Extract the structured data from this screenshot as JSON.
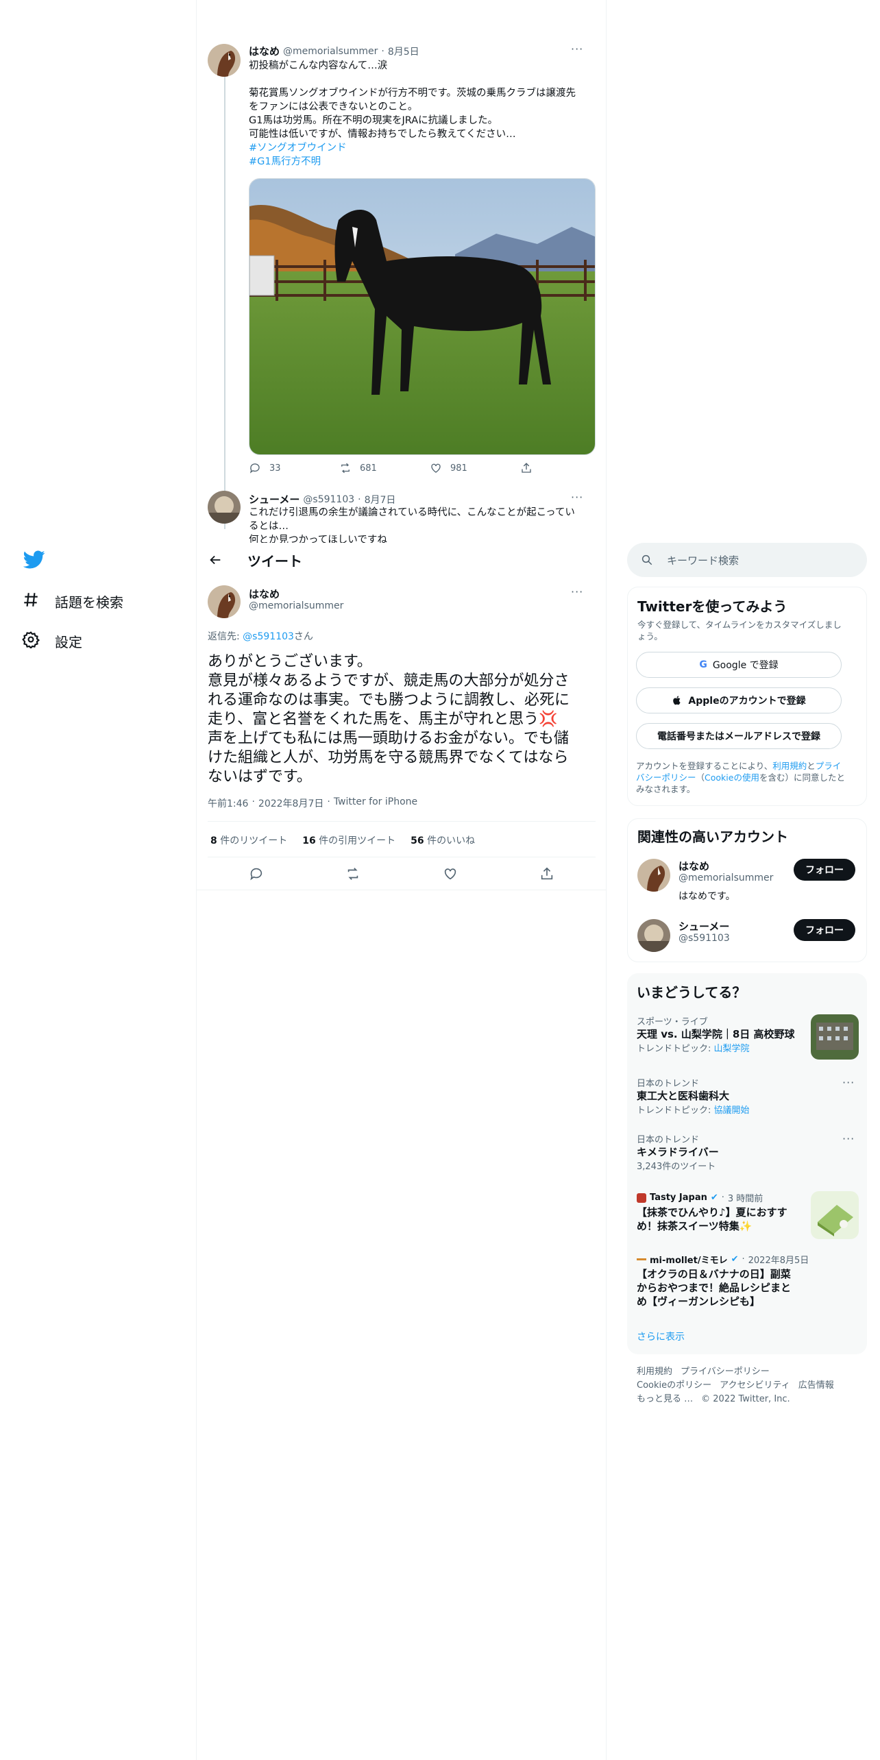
{
  "nav": {
    "items": [
      {
        "label": "話題を検索",
        "icon": "hashtag-icon"
      },
      {
        "label": "設定",
        "icon": "gear-icon"
      }
    ]
  },
  "parent_tweet": {
    "name": "はなめ",
    "handle": "@memorialsummer",
    "date": "8月5日",
    "lines": [
      "初投稿がこんな内容なんて…涙",
      "",
      "菊花賞馬ソングオブウインドが行方不明です。茨城の乗馬クラブは譲渡先",
      "をファンには公表できないとのこと。",
      "G1馬は功労馬。所在不明の現実をJRAに抗議しました。",
      "可能性は低いですが、情報お持ちでしたら教えてください…"
    ],
    "hashtags": [
      "#ソングオブウインド",
      "#G1馬行方不明"
    ],
    "reply_count": "33",
    "retweet_count": "681",
    "like_count": "981"
  },
  "reply_tweet": {
    "name": "シューメー",
    "handle": "@s591103",
    "date": "8月7日",
    "lines": [
      "これだけ引退馬の余生が議論されている時代に、こんなことが起こってい",
      "るとは…",
      "何とか見つかってほしいですね"
    ]
  },
  "header": {
    "title": "ツイート"
  },
  "main_tweet": {
    "name": "はなめ",
    "handle": "@memorialsummer",
    "reply_prefix": "返信先: ",
    "reply_to": "@s591103",
    "reply_suffix": "さん",
    "lines": [
      "ありがとうございます。",
      "意見が様々あるようですが、競走馬の大部分が処分さ",
      "れる運命なのは事実。でも勝つように調教し、必死に",
      "走り、富と名誉をくれた馬を、馬主が守れと思う💢",
      "声を上げても私には馬一頭助けるお金がない。でも儲",
      "けた組織と人が、功労馬を守る競馬界でなくてはなら",
      "ないはずです。"
    ],
    "time": "午前1:46",
    "date": "2022年8月7日",
    "source": "Twitter for iPhone",
    "retweets_num": "8",
    "retweets_label": "件のリツイート",
    "quotes_num": "16",
    "quotes_label": "件の引用ツイート",
    "likes_num": "56",
    "likes_label": "件のいいね"
  },
  "search": {
    "placeholder": "キーワード検索"
  },
  "signup": {
    "title": "Twitterを使ってみよう",
    "subtitle_lines": [
      "今すぐ登録して、タイムラインをカスタマイズしまし",
      "ょう。"
    ],
    "google_button": "Google で登録",
    "apple_button": "Appleのアカウントで登録",
    "phone_button": "電話番号またはメールアドレスで登録",
    "terms_pre": "アカウントを登録することにより、",
    "terms_link1": "利用規約",
    "terms_mid1": "と",
    "terms_link2a": "プライ",
    "terms_link2b": "バシーポリシー",
    "terms_mid2": "（",
    "terms_link3": "Cookieの使用",
    "terms_post": "を含む）に同意したと",
    "terms_post2": "みなされます。"
  },
  "relevant": {
    "title": "関連性の高いアカウント",
    "accounts": [
      {
        "name": "はなめ",
        "handle": "@memorialsummer",
        "bio": "はなめです。",
        "follow": "フォロー"
      },
      {
        "name": "シューメー",
        "handle": "@s591103",
        "bio": "",
        "follow": "フォロー"
      }
    ]
  },
  "trends": {
    "title": "いまどうしてる？",
    "items": [
      {
        "category": "スポーツ・ライブ",
        "name": "天理 vs. 山梨学院｜8日 高校野球",
        "sub_prefix": "トレンドトピック: ",
        "sub_link": "山梨学院"
      },
      {
        "category": "日本のトレンド",
        "name": "東工大と医科歯科大",
        "sub_prefix": "トレンドトピック: ",
        "sub_link": "協議開始"
      },
      {
        "category": "日本のトレンド",
        "name": "キメラドライバー",
        "sub_prefix": "3,243件のツイート",
        "sub_link": ""
      }
    ],
    "news": [
      {
        "source": "Tasty Japan",
        "time": "3 時間前",
        "title_lines": [
          "【抹茶でひんやり♪】夏におすす",
          "め！抹茶スイーツ特集✨"
        ]
      },
      {
        "source": "mi-mollet/ミモレ",
        "time": "2022年8月5日",
        "title_lines": [
          "【オクラの日＆バナナの日】副菜",
          "からおやつまで！絶品レシピまと",
          "め【ヴィーガンレシピも】"
        ]
      }
    ],
    "show_more": "さらに表示"
  },
  "footer": {
    "links_row1": [
      "利用規約",
      "プライバシーポリシー"
    ],
    "links_row2": [
      "Cookieのポリシー",
      "アクセシビリティ",
      "広告情報"
    ],
    "more": "もっと見る …",
    "copyright": "© 2022 Twitter, Inc."
  },
  "colors": {
    "accent": "#1d9bf0",
    "text": "#0f1419",
    "muted": "#536471",
    "border": "#eff3f4",
    "trend_bg": "#f7f9f9"
  }
}
